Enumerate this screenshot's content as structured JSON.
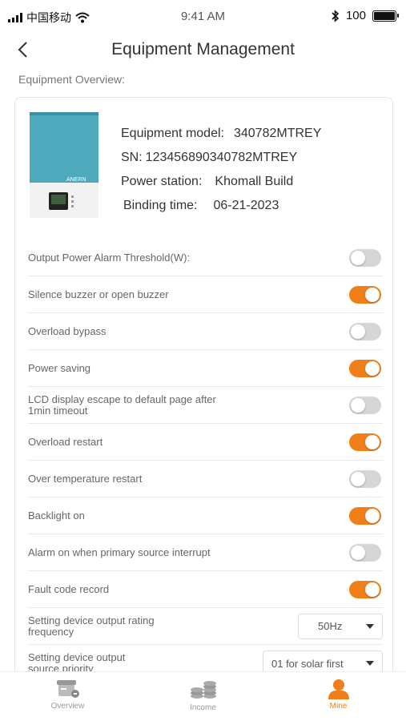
{
  "status_bar": {
    "carrier": "中国移动",
    "time": "9:41 AM",
    "battery": "100",
    "battery_level": 1.0
  },
  "nav": {
    "title": "Equipment Management"
  },
  "section_label": "Equipment Overview:",
  "device": {
    "model_label": "Equipment model:",
    "model": "340782MTREY",
    "sn_label": "SN:",
    "sn": "123456890340782MTREY",
    "station_label": "Power station:",
    "station": "Khomall Build",
    "binding_label": "Binding time:",
    "binding_time": "06-21-2023"
  },
  "settings": [
    {
      "label": "Output Power Alarm Threshold(W):",
      "on": false
    },
    {
      "label": "Silence buzzer or open buzzer",
      "on": true
    },
    {
      "label": "Overload bypass",
      "on": false
    },
    {
      "label": "Power saving",
      "on": true
    },
    {
      "label": "LCD display escape to default page after 1min timeout",
      "on": false
    },
    {
      "label": "Overload restart",
      "on": true
    },
    {
      "label": "Over temperature restart",
      "on": false
    },
    {
      "label": "Backlight on",
      "on": true
    },
    {
      "label": "Alarm on when primary source interrupt",
      "on": false
    },
    {
      "label": "Fault code record",
      "on": true
    }
  ],
  "selects": [
    {
      "label": "Setting device output rating frequency",
      "value": "50Hz"
    },
    {
      "label": "Setting device output source priority",
      "value": "01 for solar first"
    }
  ],
  "tabs": [
    {
      "label": "Overview",
      "icon": "overview-icon",
      "active": false
    },
    {
      "label": "Income",
      "icon": "income-icon",
      "active": false
    },
    {
      "label": "Mine",
      "icon": "mine-icon",
      "active": true
    }
  ],
  "colors": {
    "accent": "#f07f1a",
    "toggle_off": "#d6d6d6",
    "device_teal": "#4fa9bd"
  }
}
